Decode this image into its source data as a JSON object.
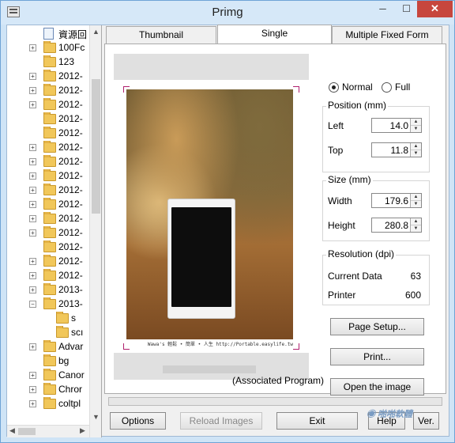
{
  "window": {
    "title": "Primg"
  },
  "tree": {
    "items": [
      {
        "label": "資源回",
        "kind": "doc",
        "expander": ""
      },
      {
        "label": "100Fc",
        "kind": "folder",
        "expander": "+"
      },
      {
        "label": "123",
        "kind": "folder",
        "expander": ""
      },
      {
        "label": "2012-",
        "kind": "folder",
        "expander": "+"
      },
      {
        "label": "2012-",
        "kind": "folder",
        "expander": "+"
      },
      {
        "label": "2012-",
        "kind": "folder",
        "expander": "+"
      },
      {
        "label": "2012-",
        "kind": "folder",
        "expander": ""
      },
      {
        "label": "2012-",
        "kind": "folder",
        "expander": ""
      },
      {
        "label": "2012-",
        "kind": "folder",
        "expander": "+"
      },
      {
        "label": "2012-",
        "kind": "folder",
        "expander": "+"
      },
      {
        "label": "2012-",
        "kind": "folder",
        "expander": "+"
      },
      {
        "label": "2012-",
        "kind": "folder",
        "expander": "+"
      },
      {
        "label": "2012-",
        "kind": "folder",
        "expander": "+"
      },
      {
        "label": "2012-",
        "kind": "folder",
        "expander": "+"
      },
      {
        "label": "2012-",
        "kind": "folder",
        "expander": "+"
      },
      {
        "label": "2012-",
        "kind": "folder",
        "expander": ""
      },
      {
        "label": "2012-",
        "kind": "folder",
        "expander": "+"
      },
      {
        "label": "2012-",
        "kind": "folder",
        "expander": "+"
      },
      {
        "label": "2013-",
        "kind": "folder",
        "expander": "+"
      },
      {
        "label": "2013-",
        "kind": "folder",
        "expander": "−"
      },
      {
        "label": "s",
        "kind": "folder",
        "expander": ""
      },
      {
        "label": "scı",
        "kind": "folder",
        "expander": ""
      },
      {
        "label": "Advar",
        "kind": "folder",
        "expander": "+"
      },
      {
        "label": "bg",
        "kind": "folder",
        "expander": ""
      },
      {
        "label": "Canor",
        "kind": "folder",
        "expander": "+"
      },
      {
        "label": "Chror",
        "kind": "folder",
        "expander": "+"
      },
      {
        "label": "coltpl",
        "kind": "folder",
        "expander": "+"
      }
    ]
  },
  "tabs": [
    {
      "label": "Thumbnail"
    },
    {
      "label": "Single"
    },
    {
      "label": "Multiple Fixed Form"
    }
  ],
  "preview": {
    "caption": "Wawa's 輕鬆 • 簡單 • 人生  http://Portable.easylife.tw"
  },
  "mode": {
    "normal": "Normal",
    "full": "Full",
    "selected": "Normal"
  },
  "position": {
    "title": "Position (mm)",
    "left_label": "Left",
    "left_value": "14.0",
    "top_label": "Top",
    "top_value": "11.8"
  },
  "size": {
    "title": "Size (mm)",
    "width_label": "Width",
    "width_value": "179.6",
    "height_label": "Height",
    "height_value": "280.8"
  },
  "resolution": {
    "title": "Resolution (dpi)",
    "current_label": "Current Data",
    "current_value": "63",
    "printer_label": "Printer",
    "printer_value": "600"
  },
  "actions": {
    "page_setup": "Page Setup...",
    "print": "Print...",
    "open_image": "Open the image",
    "associated": "(Associated Program)"
  },
  "footer": {
    "options": "Options",
    "reload": "Reload Images",
    "exit": "Exit",
    "help": "Help",
    "ver": "Ver."
  },
  "watermark": "啪啪軟體"
}
